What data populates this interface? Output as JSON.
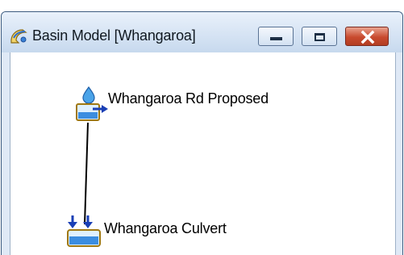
{
  "window": {
    "title": "Basin Model [Whangaroa]",
    "icon": "basin-model-icon",
    "controls": {
      "minimize_icon": "minimize-icon",
      "maximize_icon": "maximize-icon",
      "close_icon": "close-icon"
    }
  },
  "canvas": {
    "elements": [
      {
        "label": "Whangaroa Rd Proposed",
        "icon": "subbasin-icon"
      },
      {
        "label": "Whangaroa Culvert",
        "icon": "junction-icon"
      }
    ]
  },
  "colors": {
    "titlebar_top": "#e9f1fb",
    "titlebar_bottom": "#c7d9ee",
    "close_button": "#c84a2e",
    "element_blue": "#2a64c8",
    "element_outline": "#b8860b"
  }
}
